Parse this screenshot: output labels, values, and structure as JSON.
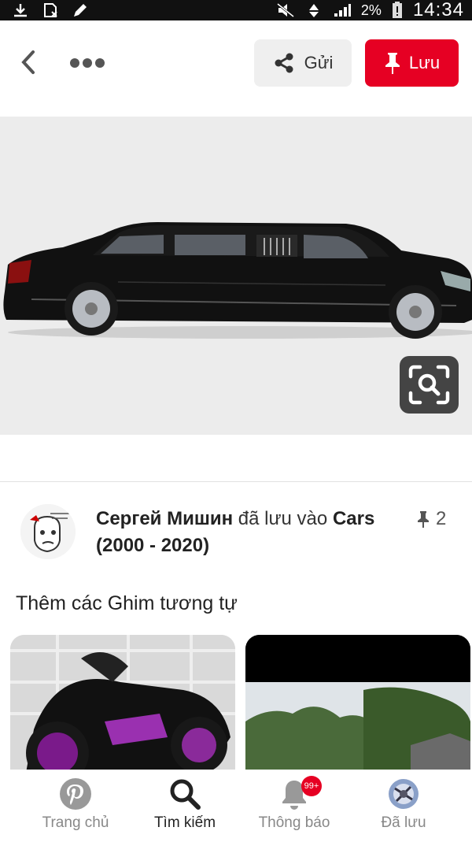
{
  "status_bar": {
    "battery_percent": "2%",
    "time": "14:34",
    "icons": [
      "download-icon",
      "no-sim-icon",
      "edit-icon",
      "mute-icon",
      "data-icon",
      "signal-icon",
      "battery-icon"
    ]
  },
  "header": {
    "back_icon": "chevron-left-icon",
    "more_icon": "ellipsis-icon",
    "share_label": "Gửi",
    "share_icon": "share-icon",
    "save_label": "Lưu",
    "save_icon": "pushpin-icon"
  },
  "pin": {
    "image_subject": "black-limousine",
    "lens_icon": "visual-search-icon",
    "saver_name": "Сергей Мишин",
    "saved_to_text": "đã lưu vào",
    "board_name": "Cars (2000 - 2020)",
    "pin_count": "2"
  },
  "related": {
    "heading": "Thêm các Ghim tương tự"
  },
  "bottom_nav": {
    "items": [
      {
        "label": "Trang chủ",
        "icon": "pinterest-icon",
        "active": false
      },
      {
        "label": "Tìm kiếm",
        "icon": "search-icon",
        "active": true
      },
      {
        "label": "Thông báo",
        "icon": "bell-icon",
        "active": false,
        "badge": "99+"
      },
      {
        "label": "Đã lưu",
        "icon": "profile-avatar",
        "active": false
      }
    ]
  },
  "colors": {
    "accent": "#e60023",
    "image_bg": "#ececec"
  }
}
